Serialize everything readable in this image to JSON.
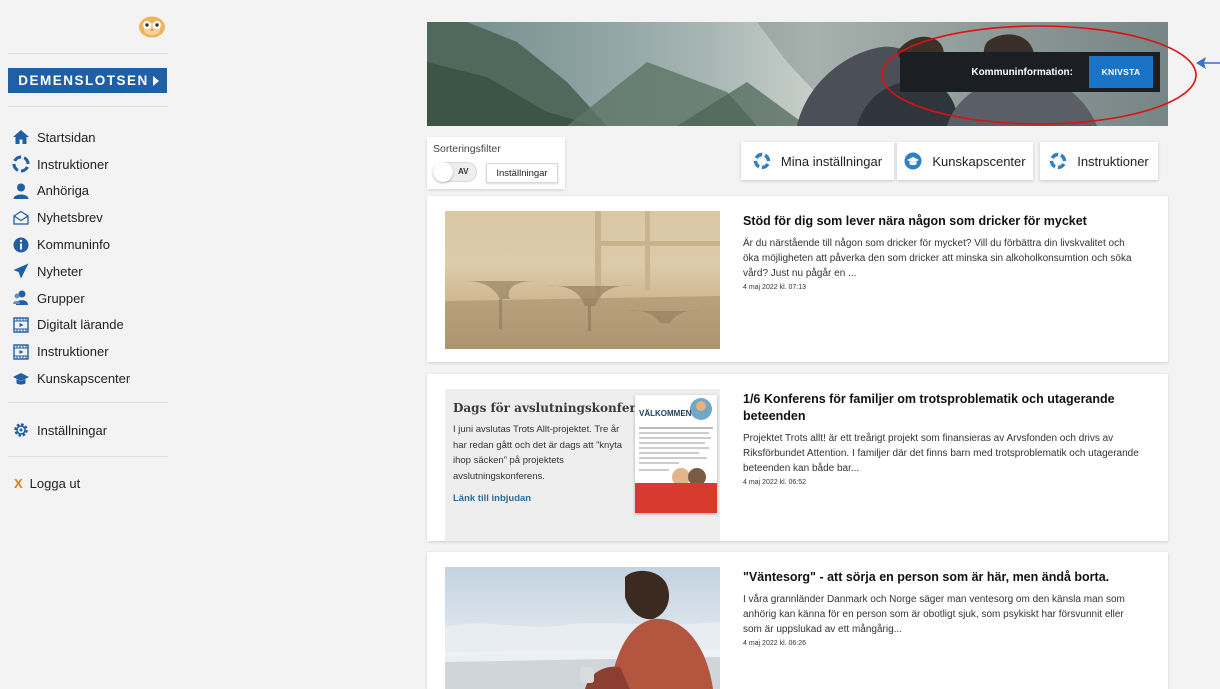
{
  "sidebar": {
    "brand_button": "DEMENSLOTSEN",
    "nav": [
      {
        "label": "Startsidan",
        "icon": "home-icon"
      },
      {
        "label": "Instruktioner",
        "icon": "lifebuoy-icon"
      },
      {
        "label": "Anhöriga",
        "icon": "person-icon"
      },
      {
        "label": "Nyhetsbrev",
        "icon": "envelope-icon"
      },
      {
        "label": "Kommuninfo",
        "icon": "info-icon"
      },
      {
        "label": "Nyheter",
        "icon": "paper-plane-icon"
      },
      {
        "label": "Grupper",
        "icon": "group-icon"
      },
      {
        "label": "Digitalt lärande",
        "icon": "film-icon"
      },
      {
        "label": "Instruktioner",
        "icon": "film-icon"
      },
      {
        "label": "Kunskapscenter",
        "icon": "graduation-cap-icon"
      }
    ],
    "settings": "Inställningar",
    "logout_x": "X",
    "logout": "Logga ut"
  },
  "banner": {
    "kommun_label": "Kommuninformation:",
    "kommun_button": "KNIVSTA"
  },
  "filter": {
    "title": "Sorteringsfilter",
    "toggle_label": "AV",
    "settings_button": "Inställningar"
  },
  "quick_buttons": [
    {
      "label": "Mina inställningar",
      "icon": "lifebuoy-icon"
    },
    {
      "label": "Kunskapscenter",
      "icon": "graduation-cap-icon"
    },
    {
      "label": "Instruktioner",
      "icon": "lifebuoy-icon"
    }
  ],
  "articles": [
    {
      "title": "Stöd för dig som lever nära någon som dricker för mycket",
      "body": "Är du närstående till någon som dricker för mycket? Vill du förbättra din livskvalitet och öka möjligheten att påverka den som dricker att minska sin alkoholkonsumtion och söka vård? Just nu pågår en ...",
      "date": "4 maj 2022 kl. 07:13"
    },
    {
      "title": "1/6 Konferens för familjer om trotsproblematik och utagerande beteenden",
      "body": "Projektet Trots allt! är ett treårigt projekt som finansieras av Arvsfonden och drivs av Riksförbundet Attention. I familjer där det finns barn med trotsproblematik och utagerande beteenden kan både bar...",
      "date": "4 maj 2022 kl. 06:52",
      "flyer": {
        "title": "Dags för avslutningskonferens",
        "body": "I juni avslutas Trots Allt-projektet. Tre år har redan gått och det är dags att ”knyta ihop säcken” på projektets avslutningskonferens.",
        "link": "Länk till inbjudan",
        "poster_heading": "VÄLKOMMEN"
      }
    },
    {
      "title": "\"Väntesorg\" - att sörja en person som är här, men ändå borta.",
      "body": "I våra grannländer Danmark och Norge säger man ventesorg om den känsla man som anhörig kan känna för en person som är obotligt sjuk, som psykiskt har försvunnit eller som är uppslukad av ett mångårig...",
      "date": "4 maj 2022 kl. 06:26"
    }
  ],
  "colors": {
    "brand_blue": "#205ea6",
    "kommun_button": "#1a73c4",
    "annotation_red": "#e01010",
    "annotation_blue": "#3b6fc9",
    "logout_x": "#e07d1a"
  }
}
